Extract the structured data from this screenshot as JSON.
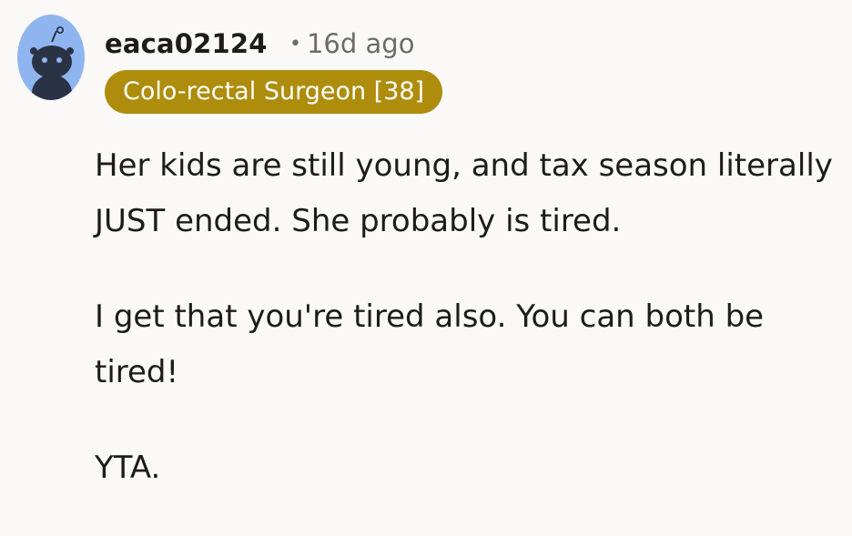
{
  "comment": {
    "avatar_icon": "snoo-avatar-icon",
    "username": "eaca02124",
    "separator": "•",
    "timestamp": "16d ago",
    "flair": "Colo-rectal Surgeon [38]",
    "flair_color": "#ae8c0c",
    "paragraphs": [
      "Her kids are still young, and tax season literally JUST ended. She probably is tired.",
      "I get that you're tired also. You can both be tired!",
      "YTA."
    ]
  }
}
